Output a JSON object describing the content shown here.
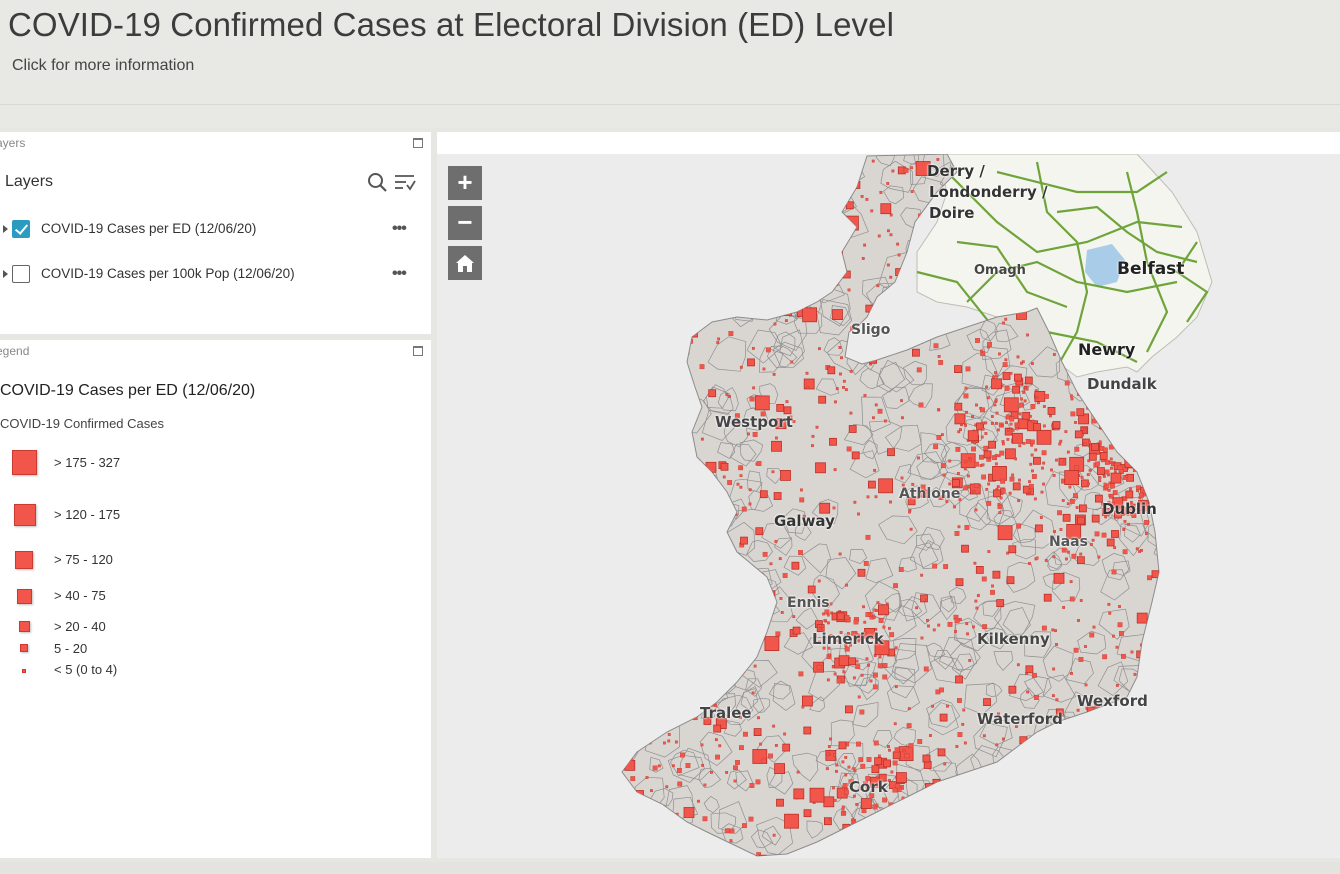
{
  "header": {
    "title": "COVID-19 Confirmed Cases at Electoral Division (ED) Level",
    "subtitle": "Click for more information"
  },
  "layers_panel": {
    "panel_title": "ayers",
    "heading": "Layers",
    "items": [
      {
        "label": "COVID-19 Cases per ED (12/06/20)",
        "checked": true
      },
      {
        "label": "COVID-19 Cases per 100k Pop (12/06/20)",
        "checked": false
      }
    ],
    "more_label": "•••"
  },
  "legend_panel": {
    "panel_title": "egend",
    "layer_title": "COVID-19 Cases per ED (12/06/20)",
    "field_title": "COVID-19 Confirmed Cases",
    "items": [
      {
        "label": "> 175 - 327"
      },
      {
        "label": "> 120 - 175"
      },
      {
        "label": "> 75 - 120"
      },
      {
        "label": "> 40 - 75"
      },
      {
        "label": "> 20 - 40"
      },
      {
        "label": "5 - 20"
      },
      {
        "label": "< 5 (0 to 4)"
      }
    ]
  },
  "map": {
    "zoom_in_label": "+",
    "zoom_out_label": "−",
    "places": [
      {
        "name": "Derry /"
      },
      {
        "name": "Londonderry /"
      },
      {
        "name": "Doire"
      },
      {
        "name": "Omagh"
      },
      {
        "name": "Belfast"
      },
      {
        "name": "Sligo"
      },
      {
        "name": "Newry"
      },
      {
        "name": "Dundalk"
      },
      {
        "name": "Westport"
      },
      {
        "name": "Athlone"
      },
      {
        "name": "Galway"
      },
      {
        "name": "Dublin"
      },
      {
        "name": "Naas"
      },
      {
        "name": "Ennis"
      },
      {
        "name": "Limerick"
      },
      {
        "name": "Kilkenny"
      },
      {
        "name": "Tralee"
      },
      {
        "name": "Waterford"
      },
      {
        "name": "Wexford"
      },
      {
        "name": "Cork"
      }
    ]
  },
  "colors": {
    "case_symbol": "#f2554a",
    "checkbox_checked": "#2b9bc0",
    "land": "#d9d6d2",
    "northern_ireland": "#f4f4ee",
    "roads": "#6ea43a"
  }
}
